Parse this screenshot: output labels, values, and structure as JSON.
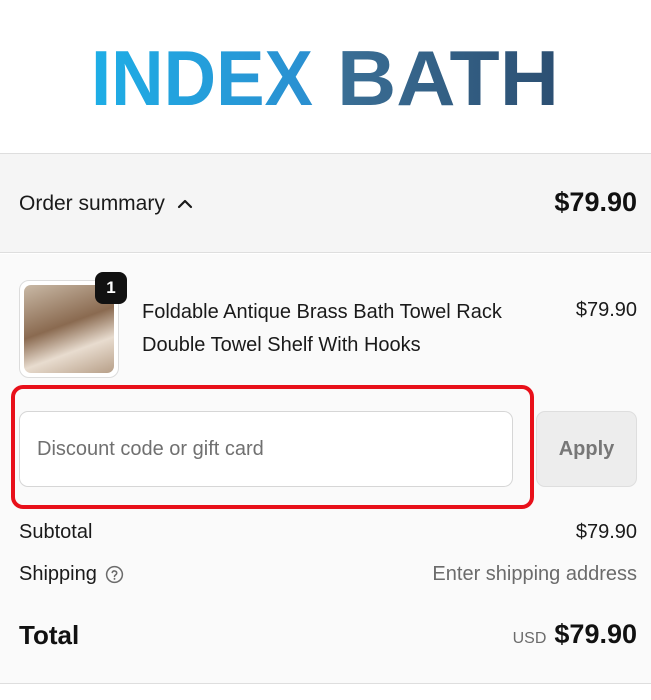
{
  "brand": {
    "logo_text_left": "INDEX",
    "logo_text_right": "BATH",
    "colors": {
      "logo_left": "#1ea7e1",
      "logo_right": "#2f5f86",
      "logo_accent": "#3da0dd"
    }
  },
  "summary": {
    "toggle_label": "Order summary",
    "toggle_icon": "chevron-up-icon",
    "total": "$79.90"
  },
  "line_item": {
    "quantity": "1",
    "name": "Foldable Antique Brass Bath Towel Rack Double Towel Shelf With Hooks",
    "price": "$79.90"
  },
  "discount": {
    "placeholder": "Discount code or gift card",
    "value": "",
    "apply_label": "Apply"
  },
  "totals": {
    "subtotal_label": "Subtotal",
    "subtotal_value": "$79.90",
    "shipping_label": "Shipping",
    "shipping_help_icon": "question-circle-icon",
    "shipping_value": "Enter shipping address",
    "total_label": "Total",
    "currency": "USD",
    "total_value": "$79.90"
  },
  "annotation": {
    "highlight_color": "#e8101a"
  }
}
